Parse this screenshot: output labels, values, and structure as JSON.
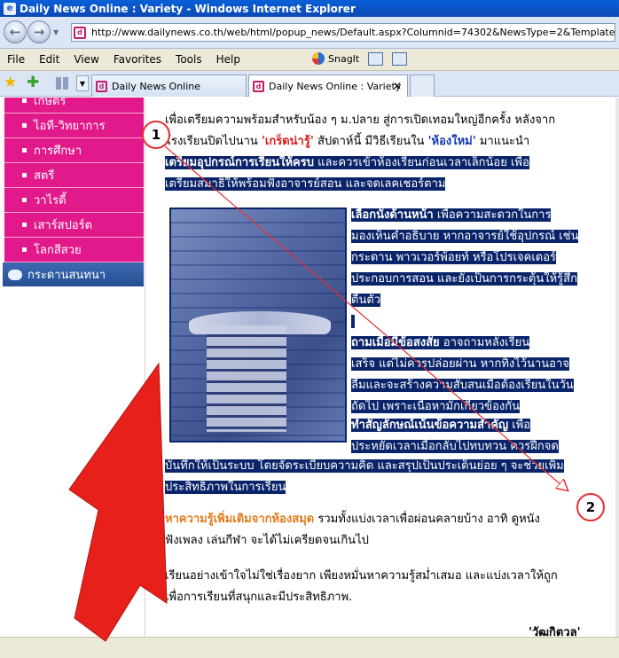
{
  "window": {
    "title": "Daily News Online : Variety - Windows Internet Explorer"
  },
  "address": {
    "url": "http://www.dailynews.co.th/web/html/popup_news/Default.aspx?Columnid=74302&NewsType=2&Template=1"
  },
  "menu": {
    "items": [
      "File",
      "Edit",
      "View",
      "Favorites",
      "Tools",
      "Help"
    ],
    "snagit": "SnagIt"
  },
  "tabs": [
    {
      "label": "Daily News Online",
      "active": false
    },
    {
      "label": "Daily News Online : Variety",
      "active": true
    }
  ],
  "sidebar": {
    "items": [
      "เกษตร",
      "ไอที-วิทยาการ",
      "การศึกษา",
      "สตรี",
      "วาไรตี้",
      "เสาร์สปอร์ต",
      "โลกสีสวย"
    ],
    "section_title": "กระดานสนทนา",
    "colors": {
      "item_bg": "#e2198a",
      "section_bg": "#2c5aa0"
    }
  },
  "article": {
    "intro_line1": "เพื่อเตรียมความพร้อมสำหรับน้อง ๆ ม.ปลาย สู่การเปิดเทอมใหญ่อีกครั้ง หลังจาก",
    "intro_line2_pre": "โรงเรียนปิดไปนาน ",
    "intro_term1": "'เกร็ดน่ารู้'",
    "intro_line2_mid": " สัปดาห์นี้ มีวิธีเรียนใน ",
    "intro_term2": "'ห้องใหม่'",
    "intro_line2_post": " มาแนะนำ",
    "tip1_title": "เตรียมอุปกรณ์การเรียนให้ครบ",
    "tip1_text": " และควรเข้าห้องเรียนก่อนเวลาเล็กน้อย เพื่อ",
    "tip1_line2": "เตรียมสมาธิให้พร้อมฟังอาจารย์สอน และจดเลคเชอร์ตาม",
    "tip2_title": "เลือกนั่งด้านหน้า",
    "tip2_l1": " เพื่อความสะดวกในการ",
    "tip2_l2": "มองเห็นคำอธิบาย หากอาจารย์ใช้อุปกรณ์ เช่น",
    "tip2_l3": "กระดาน พาวเวอร์พ้อยท์ หรือโปรเจคเตอร์",
    "tip2_l4": "ประกอบการสอน และยังเป็นการกระตุ้นให้รู้สึก",
    "tip2_l5": "ตื่นตัว",
    "tip3_title": "ถามเมื่อมีข้อสงสัย",
    "tip3_l1": " อาจถามหลังเรียน",
    "tip3_l2": "เสร็จ แต่ไม่ควรปล่อยผ่าน หากทิ้งไว้นานอาจ",
    "tip3_l3": "ลืมและจะสร้างความสับสนเมื่อต้องเรียนในวัน",
    "tip3_l4": "ถัดไป เพราะเนื้อหามักเกี่ยวข้องกัน",
    "tip4_title": "ทำสัญลักษณ์เน้นข้อความสำคัญ",
    "tip4_l1": " เพื่อ",
    "tip4_l2": "ประหยัดเวลาเมื่อกลับไปทบทวน ควรฝึกจด",
    "tip4_l3": "บันทึกให้เป็นระบบ โดยจัดระเบียบความคิด และสรุปเป็นประเด็นย่อย ๆ จะช่วยเพิ่ม",
    "tip4_l4": "ประสิทธิภาพในการเรียน",
    "tip5_title": "หาความรู้เพิ่มเติมจากห้องสมุด",
    "tip5_l1": " รวมทั้งแบ่งเวลาเพื่อผ่อนคลายบ้าง อาทิ ดูหนัง",
    "tip5_l2": "ฟังเพลง เล่นกีฬา จะได้ไม่เครียดจนเกินไป",
    "outro_l1": "เรียนอย่างเข้าใจไม่ใช่เรื่องยาก เพียงหมั่นหาความรู้สม่ำเสมอ และแบ่งเวลาให้ถูก",
    "outro_l2": "เพื่อการเรียนที่สนุกและมีประสิทธิภาพ.",
    "signature": "'วัฒกิตวล'"
  },
  "annotations": {
    "callout1": "1",
    "callout2": "2",
    "arrow_color": "#e8201c"
  }
}
